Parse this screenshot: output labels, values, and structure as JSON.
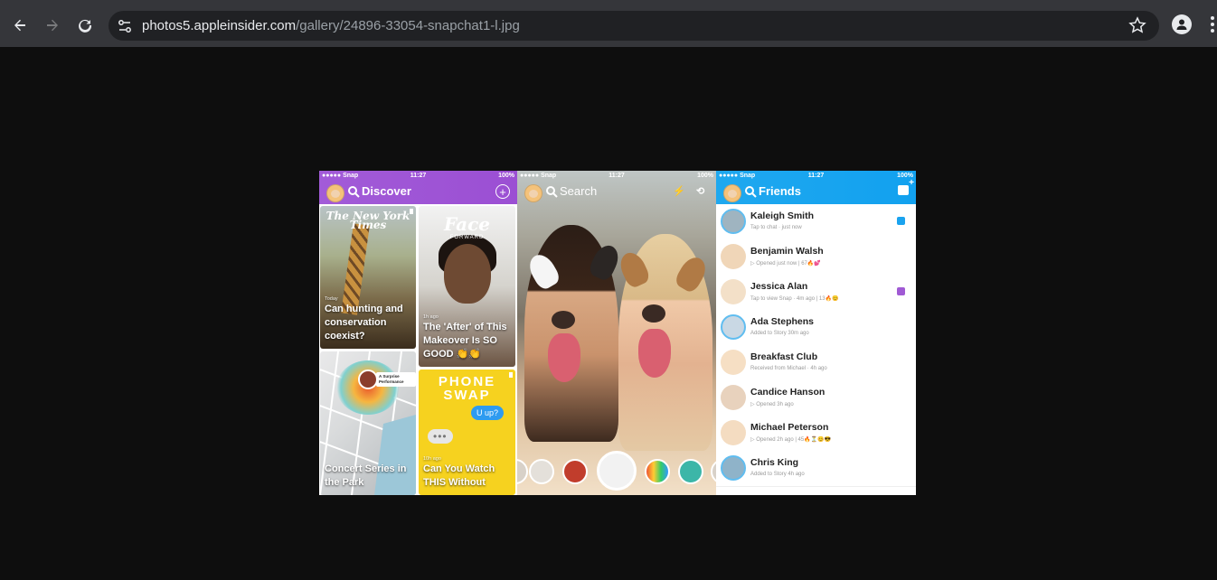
{
  "browser": {
    "back_icon": "arrow-left-icon",
    "forward_icon": "arrow-right-icon",
    "reload_icon": "reload-icon",
    "url_host": "photos5.appleinsider.com",
    "url_path": "/gallery/24896-33054-snapchat1-l.jpg",
    "bookmark_icon": "star-icon",
    "profile_icon": "profile-icon",
    "menu_icon": "more-vert-icon"
  },
  "image": {
    "discover": {
      "status": {
        "carrier": "●●●●● Snap",
        "time": "11:27",
        "battery": "100%"
      },
      "title": "Discover",
      "cards": [
        {
          "logo": "The New York Times",
          "kicker": "Today",
          "caption": "Can hunting and conservation coexist?"
        },
        {
          "logo": "Face",
          "logo_sub": "FORWARD",
          "kicker": "1h ago",
          "caption": "The 'After' of This Makeover Is SO GOOD 👏👏"
        },
        {
          "pin_label": "A Surprise Performance",
          "caption": "Concert Series in the Park"
        },
        {
          "logo": "PHONE SWAP",
          "bubble_blue": "U up?",
          "bubble_grey": "•••",
          "kicker": "10h ago",
          "caption": "Can You Watch THIS Without"
        }
      ]
    },
    "camera": {
      "status": {
        "carrier": "●●●●● Snap",
        "time": "11:27",
        "battery": "100%"
      },
      "title": "Search"
    },
    "friends": {
      "status": {
        "carrier": "●●●●● Snap",
        "time": "11:27",
        "battery": "100%"
      },
      "title": "Friends",
      "items": [
        {
          "name": "Kaleigh Smith",
          "sub": "Tap to chat · just now",
          "badge": "#1aa3ef",
          "story": true
        },
        {
          "name": "Benjamin Walsh",
          "sub": "▷ Opened just now  |  67🔥💕",
          "badge": "",
          "story": false
        },
        {
          "name": "Jessica Alan",
          "sub": "Tap to view Snap · 4m ago  |  13🔥😊",
          "badge": "#a05ad4",
          "story": false
        },
        {
          "name": "Ada Stephens",
          "sub": "Added to Story 30m ago",
          "badge": "",
          "story": true
        },
        {
          "name": "Breakfast Club",
          "sub": "Received from Michael · 4h ago",
          "badge": "",
          "story": false
        },
        {
          "name": "Candice Hanson",
          "sub": "▷ Opened 3h ago",
          "badge": "",
          "story": false
        },
        {
          "name": "Michael Peterson",
          "sub": "▷ Opened 2h ago  |  45🔥⏳😊😎",
          "badge": "",
          "story": false
        },
        {
          "name": "Chris King",
          "sub": "Added to Story 4h ago",
          "badge": "",
          "story": true
        }
      ]
    }
  }
}
